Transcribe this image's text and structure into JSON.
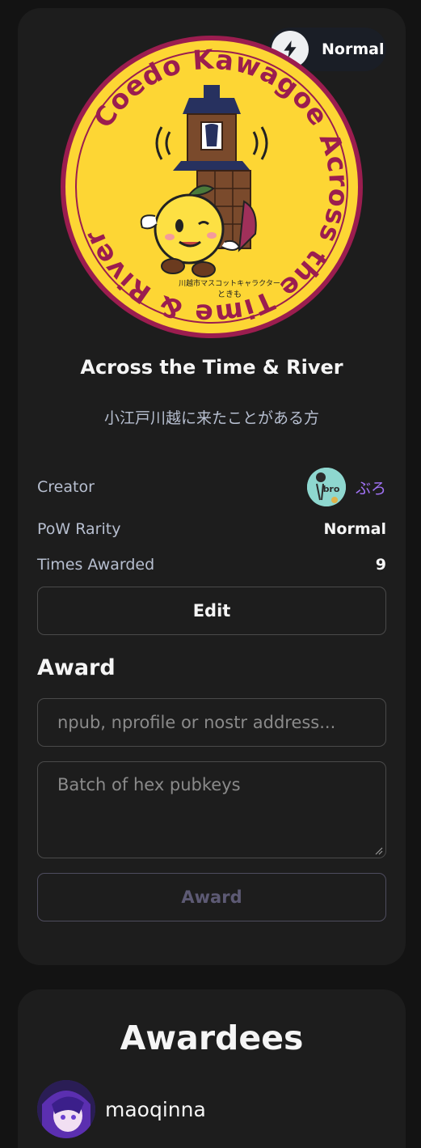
{
  "badge": {
    "rarity_label": "Normal",
    "title": "Across the Time & River",
    "description": "小江戸川越に来たことがある方",
    "image": {
      "ring_text": "Coedo Kawagoe Across the Time & River",
      "caption_line1": "川越市マスコットキャラクター",
      "caption_line2": "ときも"
    }
  },
  "details": {
    "creator_label": "Creator",
    "creator_name": "ぶろ",
    "creator_avatar_text": "bro",
    "pow_label": "PoW Rarity",
    "pow_value": "Normal",
    "times_label": "Times Awarded",
    "times_value": "9"
  },
  "actions": {
    "edit_label": "Edit"
  },
  "award": {
    "section_title": "Award",
    "npub_placeholder": "npub, nprofile or nostr address...",
    "batch_placeholder": "Batch of hex pubkeys",
    "button_label": "Award"
  },
  "awardees": {
    "title": "Awardees",
    "items": [
      {
        "name": "maoqinna"
      }
    ]
  },
  "colors": {
    "card_bg": "#1d1d1d",
    "page_bg": "#131313",
    "accent_purple": "#a172f5",
    "badge_yellow": "#fdd634",
    "badge_ring": "#9b1d4f",
    "muted_text": "#b7bfd0"
  },
  "icons": [
    "lightning-bolt-icon",
    "resize-grip-icon"
  ]
}
